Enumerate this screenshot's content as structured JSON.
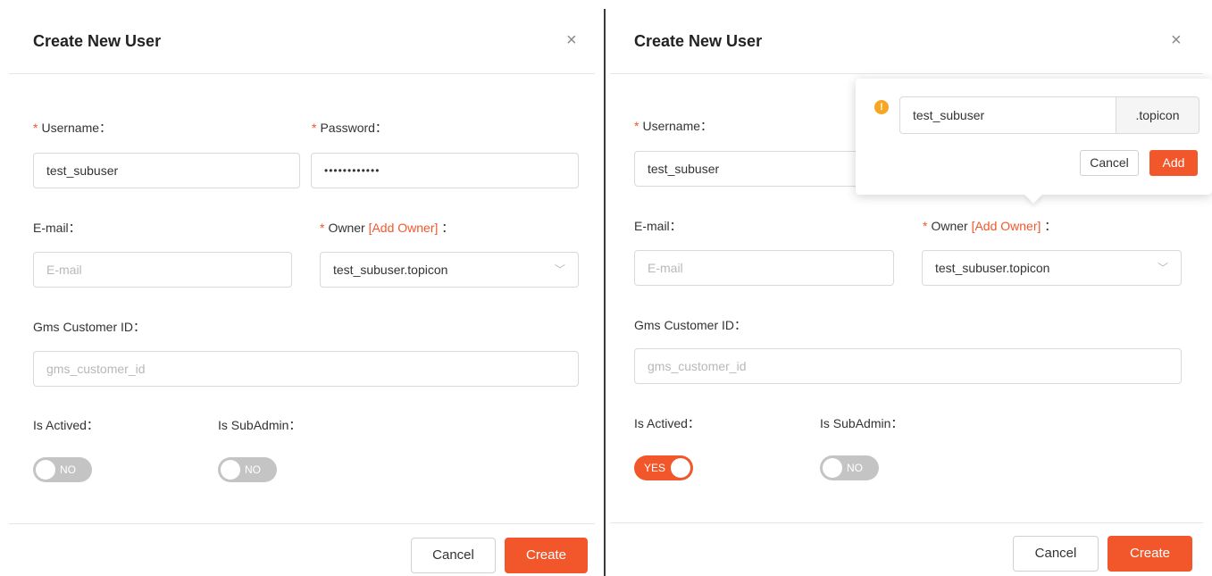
{
  "left": {
    "title": "Create New User",
    "close": "×",
    "username": {
      "label": "Username：",
      "value": "test_subuser"
    },
    "password": {
      "label": "Password：",
      "value": "••••••••••••"
    },
    "email": {
      "label": "E-mail：",
      "placeholder": "E-mail"
    },
    "owner": {
      "label": "Owner",
      "link": "[Add Owner]",
      "suffix": "：",
      "value": "test_subuser.topicon"
    },
    "gms": {
      "label": "Gms Customer ID：",
      "placeholder": "gms_customer_id"
    },
    "is_actived": {
      "label": "Is Actived：",
      "state": "NO"
    },
    "is_subadmin": {
      "label": "Is SubAdmin：",
      "state": "NO"
    },
    "cancel": "Cancel",
    "create": "Create"
  },
  "right": {
    "title": "Create New User",
    "close": "×",
    "username": {
      "label": "Username：",
      "value": "test_subuser"
    },
    "email": {
      "label": "E-mail：",
      "placeholder": "E-mail"
    },
    "owner": {
      "label": "Owner",
      "link": "[Add Owner]",
      "suffix": "：",
      "value": "test_subuser.topicon"
    },
    "gms": {
      "label": "Gms Customer ID：",
      "placeholder": "gms_customer_id"
    },
    "is_actived": {
      "label": "Is Actived：",
      "state": "YES"
    },
    "is_subadmin": {
      "label": "Is SubAdmin：",
      "state": "NO"
    },
    "cancel": "Cancel",
    "create": "Create",
    "popover": {
      "icon": "!",
      "icon_name": "warning-icon",
      "input_value": "test_subuser",
      "suffix": ".topicon",
      "cancel": "Cancel",
      "add": "Add"
    }
  },
  "colors": {
    "accent": "#f2572b",
    "toggle_off": "#c4c4c4",
    "warning": "#f5a623"
  }
}
